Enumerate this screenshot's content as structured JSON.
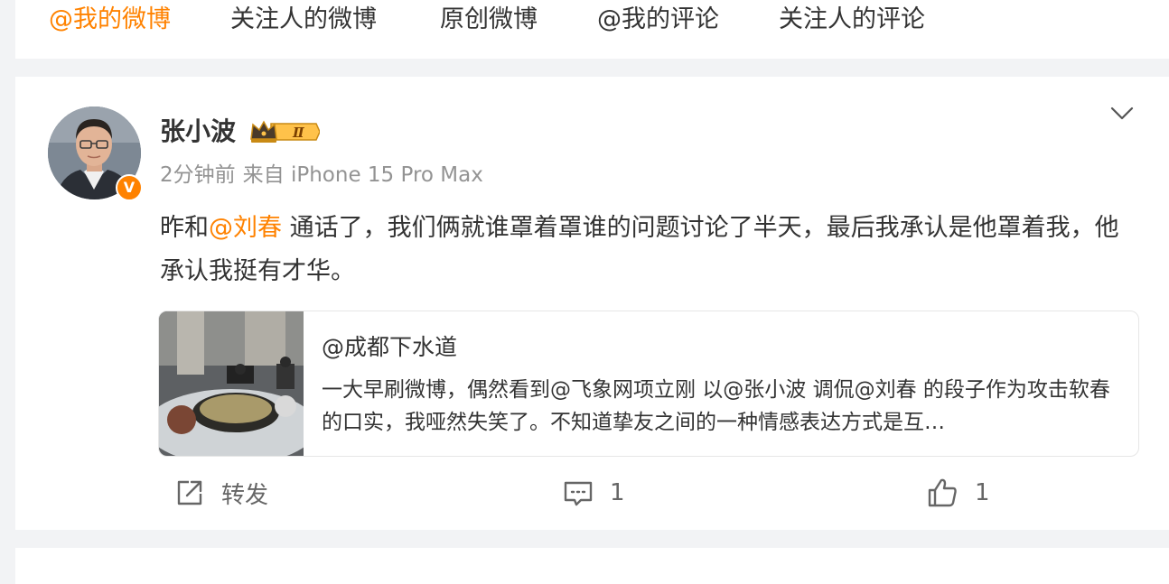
{
  "tabs": [
    {
      "label": "@我的微博",
      "active": true
    },
    {
      "label": "关注人的微博",
      "active": false
    },
    {
      "label": "原创微博",
      "active": false
    },
    {
      "label": "@我的评论",
      "active": false
    },
    {
      "label": "关注人的评论",
      "active": false
    }
  ],
  "post": {
    "author": "张小波",
    "vip_level": "Ⅱ",
    "verified_badge": "V",
    "time": "2分钟前",
    "source": "来自 iPhone 15 Pro Max",
    "text_before": "昨和",
    "mention": "@刘春",
    "text_after": " 通话了，我们俩就谁罩着罩谁的问题讨论了半天，最后我承认是他罩着我，他承认我挺有才华。",
    "repost": {
      "title": "@成都下水道",
      "desc": "一大早刷微博，偶然看到@飞象网项立刚 以@张小波 调侃@刘春 的段子作为攻击软春的口实，我哑然失笑了。不知道挚友之间的一种情感表达方式是互…"
    },
    "actions": {
      "repost_label": "转发",
      "comment_count": "1",
      "like_count": "1"
    }
  },
  "colors": {
    "accent": "#ff8200",
    "page_bg": "#f2f3f5",
    "card_bg": "#ffffff"
  },
  "icons": [
    "chevron-down-icon",
    "repost-icon",
    "comment-icon",
    "like-icon",
    "vip-crown-icon"
  ]
}
